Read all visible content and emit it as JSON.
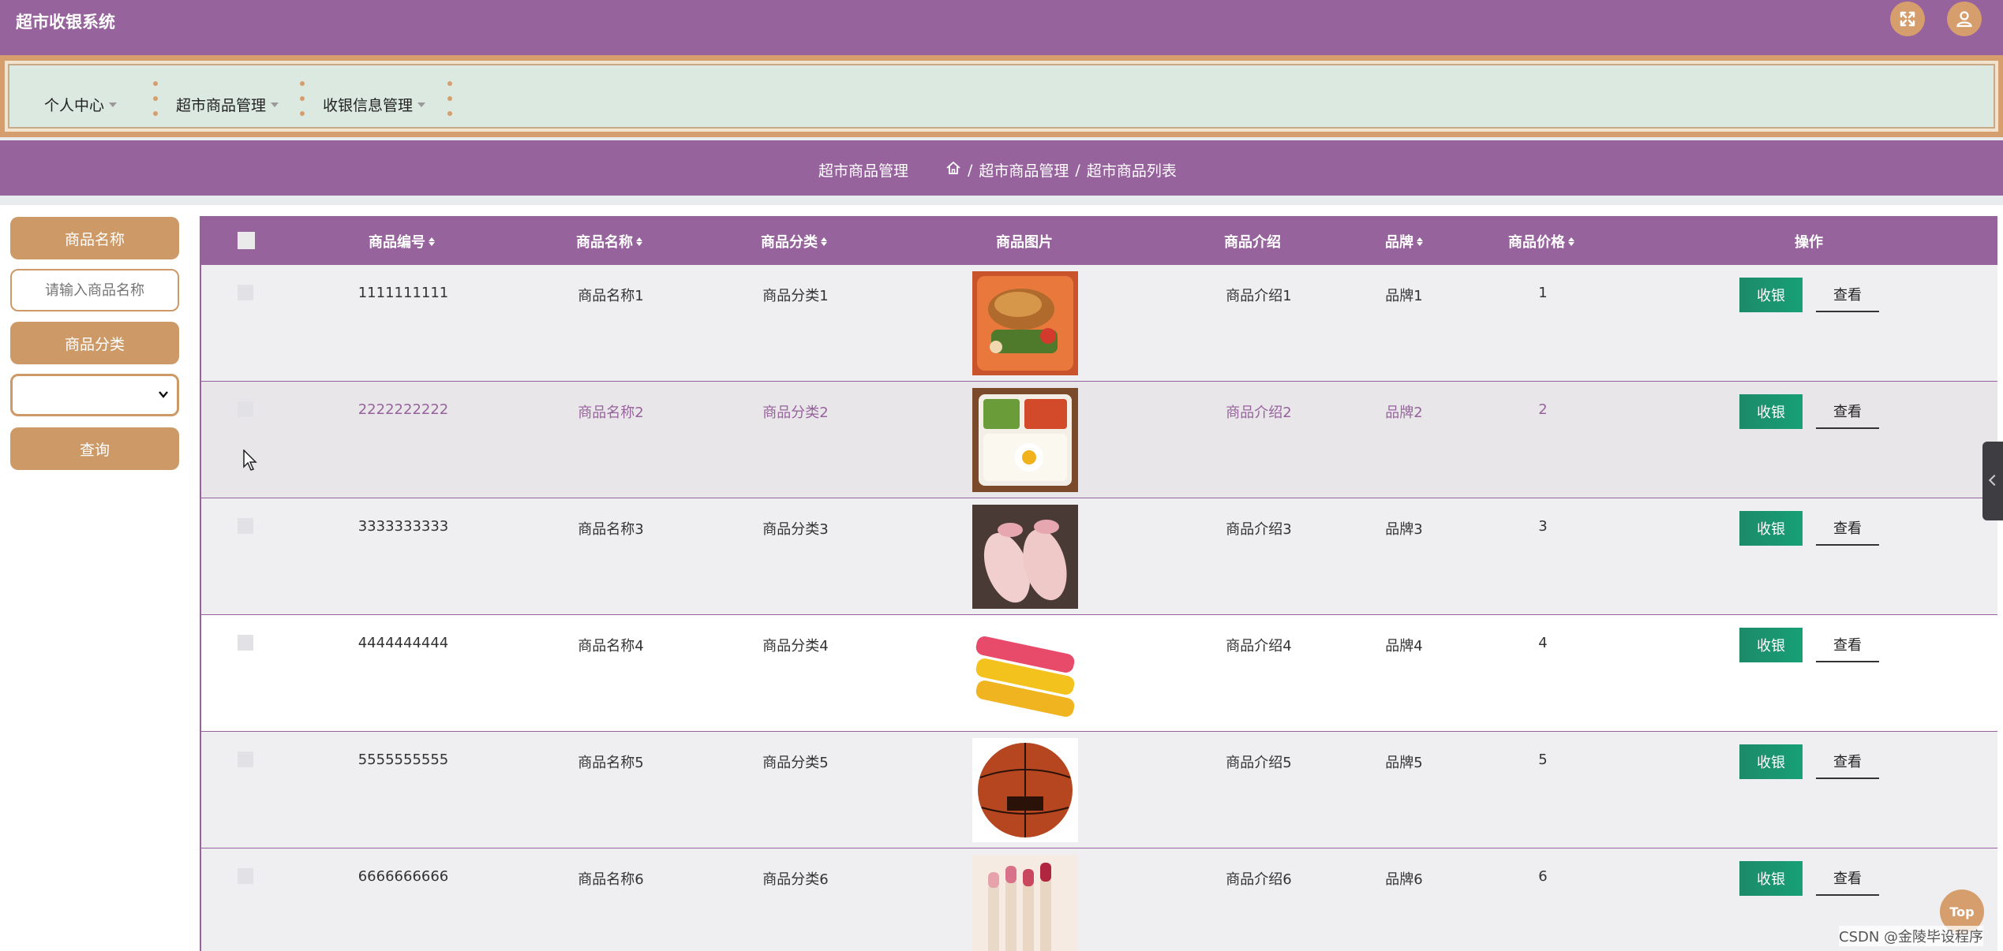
{
  "header": {
    "title": "超市收银系统",
    "icons": [
      "fullscreen-icon",
      "user-icon"
    ]
  },
  "menu": [
    {
      "label": "个人中心"
    },
    {
      "label": "超市商品管理"
    },
    {
      "label": "收银信息管理"
    }
  ],
  "breadcrumb": {
    "title": "超市商品管理",
    "path": [
      "超市商品管理",
      "超市商品列表"
    ],
    "sep": "/"
  },
  "search": {
    "name_label": "商品名称",
    "name_placeholder": "请输入商品名称",
    "name_value": "",
    "category_label": "商品分类",
    "category_value": "",
    "query_label": "查询"
  },
  "table": {
    "headers": {
      "code": "商品编号",
      "name": "商品名称",
      "category": "商品分类",
      "image": "商品图片",
      "intro": "商品介绍",
      "brand": "品牌",
      "price": "商品价格",
      "ops": "操作"
    },
    "rows": [
      {
        "code": "1111111111",
        "name": "商品名称1",
        "category": "商品分类1",
        "image": "fried-food-photo",
        "intro": "商品介绍1",
        "brand": "品牌1",
        "price": "1"
      },
      {
        "code": "2222222222",
        "name": "商品名称2",
        "category": "商品分类2",
        "image": "bento-photo",
        "intro": "商品介绍2",
        "brand": "品牌2",
        "price": "2"
      },
      {
        "code": "3333333333",
        "name": "商品名称3",
        "category": "商品分类3",
        "image": "pink-shoes-photo",
        "intro": "商品介绍3",
        "brand": "品牌3",
        "price": "3"
      },
      {
        "code": "4444444444",
        "name": "商品名称4",
        "category": "商品分类4",
        "image": "snack-rolls-photo",
        "intro": "商品介绍4",
        "brand": "品牌4",
        "price": "4"
      },
      {
        "code": "5555555555",
        "name": "商品名称5",
        "category": "商品分类5",
        "image": "basketball-photo",
        "intro": "商品介绍5",
        "brand": "品牌5",
        "price": "5"
      },
      {
        "code": "6666666666",
        "name": "商品名称6",
        "category": "商品分类6",
        "image": "lipstick-photo",
        "intro": "商品介绍6",
        "brand": "品牌6",
        "price": "6"
      }
    ],
    "actions": {
      "cash": "收银",
      "view": "查看"
    }
  },
  "floating": {
    "top_label": "Top",
    "watermark": "CSDN @金陵毕设程序"
  },
  "colors": {
    "primary": "#96639c",
    "accent": "#d79e6d",
    "cash_button": "#1d8a68"
  }
}
